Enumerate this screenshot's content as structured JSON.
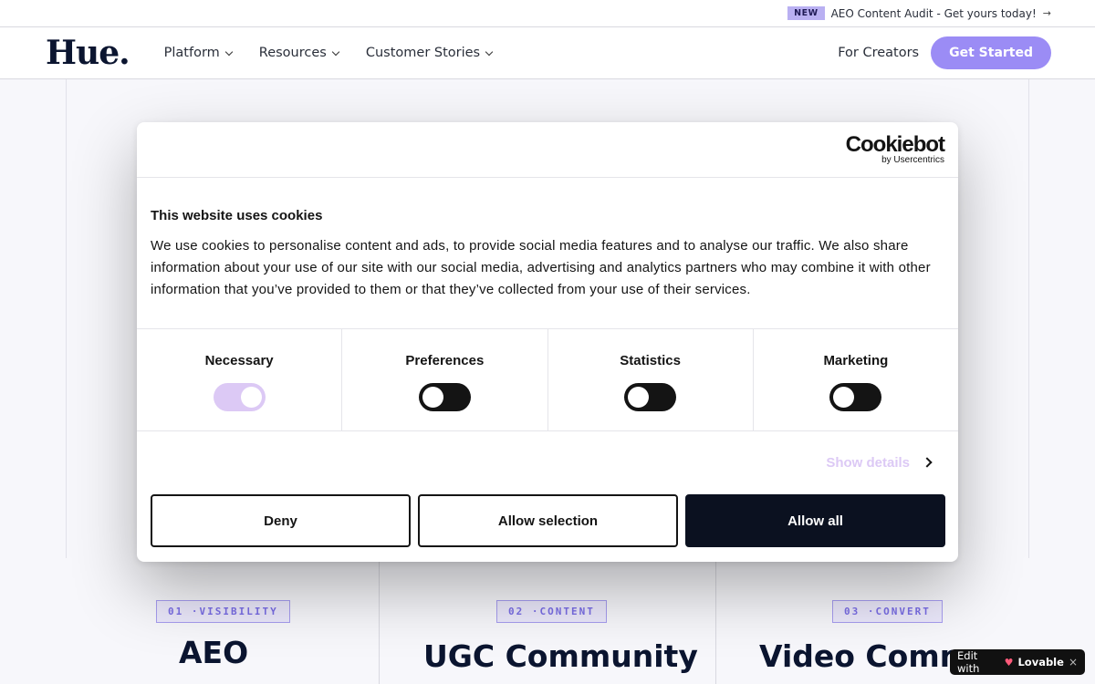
{
  "announcement": {
    "badge": "NEW",
    "text": "AEO Content Audit - Get yours today!",
    "arrow": "→"
  },
  "header": {
    "logo": "Hue.",
    "nav": [
      {
        "label": "Platform"
      },
      {
        "label": "Resources"
      },
      {
        "label": "Customer Stories"
      }
    ],
    "creators_link": "For Creators",
    "cta": "Get Started"
  },
  "cookie_dialog": {
    "brand": "Cookiebot",
    "brand_by": "by Usercentrics",
    "title": "This website uses cookies",
    "text": "We use cookies to personalise content and ads, to provide social media features and to analyse our traffic. We also share information about your use of our site with our social media, advertising and analytics partners who may combine it with other information that you’ve provided to them or that they’ve collected from your use of their services.",
    "toggles": [
      {
        "label": "Necessary",
        "checked": true,
        "disabled": true
      },
      {
        "label": "Preferences",
        "checked": false
      },
      {
        "label": "Statistics",
        "checked": false
      },
      {
        "label": "Marketing",
        "checked": false
      }
    ],
    "show_details": "Show details",
    "buttons": {
      "deny": "Deny",
      "allow_selection": "Allow selection",
      "allow_all": "Allow all"
    }
  },
  "features": [
    {
      "tag": "01 ·VISIBILITY",
      "title": "AEO"
    },
    {
      "tag": "02 ·CONTENT",
      "title": "UGC Community"
    },
    {
      "tag": "03 ·CONVERT",
      "title": "Video Comm"
    }
  ],
  "lovable_badge": {
    "prefix": "Edit with",
    "brand": "Lovable",
    "close": "×"
  },
  "colors": {
    "accent": "#9b8cf5",
    "badge": "#b9b0f2",
    "tag_text": "#7a6ee6",
    "toggle_on": "#dcc9f5",
    "dark": "#0b1120"
  }
}
